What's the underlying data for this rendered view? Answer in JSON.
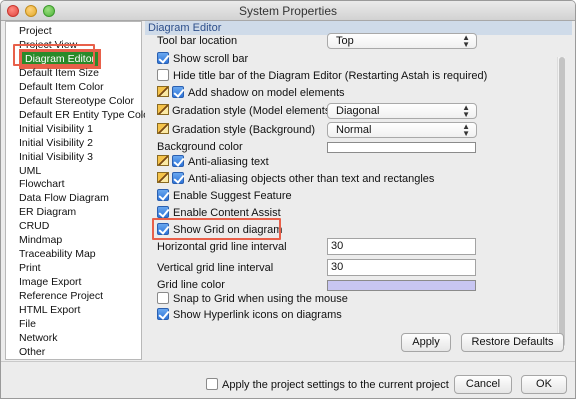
{
  "window": {
    "title": "System Properties"
  },
  "sidebar": {
    "items": [
      {
        "label": "Project",
        "selected": false
      },
      {
        "label": "Project View",
        "selected": false
      },
      {
        "label": "Diagram Editor",
        "selected": true
      },
      {
        "label": "Default Item Size",
        "selected": false
      },
      {
        "label": "Default Item Color",
        "selected": false
      },
      {
        "label": "Default Stereotype Color",
        "selected": false
      },
      {
        "label": "Default ER Entity Type Color",
        "selected": false
      },
      {
        "label": "Initial Visibility 1",
        "selected": false
      },
      {
        "label": "Initial Visibility 2",
        "selected": false
      },
      {
        "label": "Initial Visibility 3",
        "selected": false
      },
      {
        "label": "UML",
        "selected": false
      },
      {
        "label": "Flowchart",
        "selected": false
      },
      {
        "label": "Data Flow Diagram",
        "selected": false
      },
      {
        "label": "ER Diagram",
        "selected": false
      },
      {
        "label": "CRUD",
        "selected": false
      },
      {
        "label": "Mindmap",
        "selected": false
      },
      {
        "label": "Traceability Map",
        "selected": false
      },
      {
        "label": "Print",
        "selected": false
      },
      {
        "label": "Image Export",
        "selected": false
      },
      {
        "label": "Reference Project",
        "selected": false
      },
      {
        "label": "HTML Export",
        "selected": false
      },
      {
        "label": "File",
        "selected": false
      },
      {
        "label": "Network",
        "selected": false
      },
      {
        "label": "Other",
        "selected": false
      }
    ]
  },
  "panel": {
    "header": "Diagram Editor",
    "toolbar_location": {
      "label": "Tool bar location",
      "value": "Top"
    },
    "show_scroll_bar": {
      "label": "Show scroll bar",
      "checked": true
    },
    "hide_title_bar": {
      "label": "Hide title bar of the Diagram Editor (Restarting Astah is required)",
      "checked": false
    },
    "add_shadow": {
      "label": "Add shadow on model elements",
      "checked": true
    },
    "gradation_model": {
      "label": "Gradation style (Model elements)",
      "value": "Diagonal"
    },
    "gradation_bg": {
      "label": "Gradation style (Background)",
      "value": "Normal"
    },
    "background_color": {
      "label": "Background color",
      "color": "#ffffff"
    },
    "anti_alias_text": {
      "label": "Anti-aliasing text",
      "checked": true
    },
    "anti_alias_other": {
      "label": "Anti-aliasing objects other than text and rectangles",
      "checked": true
    },
    "enable_suggest": {
      "label": "Enable Suggest Feature",
      "checked": true
    },
    "enable_content_assist": {
      "label": "Enable Content Assist",
      "checked": true
    },
    "show_grid": {
      "label": "Show Grid on diagram",
      "checked": true
    },
    "h_grid_interval": {
      "label": "Horizontal grid line interval",
      "value": "30"
    },
    "v_grid_interval": {
      "label": "Vertical grid line interval",
      "value": "30"
    },
    "grid_line_color": {
      "label": "Grid line color",
      "color": "#c8c6f2"
    },
    "snap_to_grid": {
      "label": "Snap to Grid when using the mouse",
      "checked": false
    },
    "show_hyperlink_icons": {
      "label": "Show Hyperlink icons on diagrams",
      "checked": true
    },
    "apply_label": "Apply",
    "restore_label": "Restore Defaults"
  },
  "footer": {
    "apply_project_settings": {
      "label": "Apply the project settings to the current project",
      "checked": false
    },
    "cancel_label": "Cancel",
    "ok_label": "OK"
  },
  "colors": {
    "highlight": "#e8604a",
    "selected_bg": "#2a8a2a",
    "header_bg": "#cfdbe9"
  }
}
